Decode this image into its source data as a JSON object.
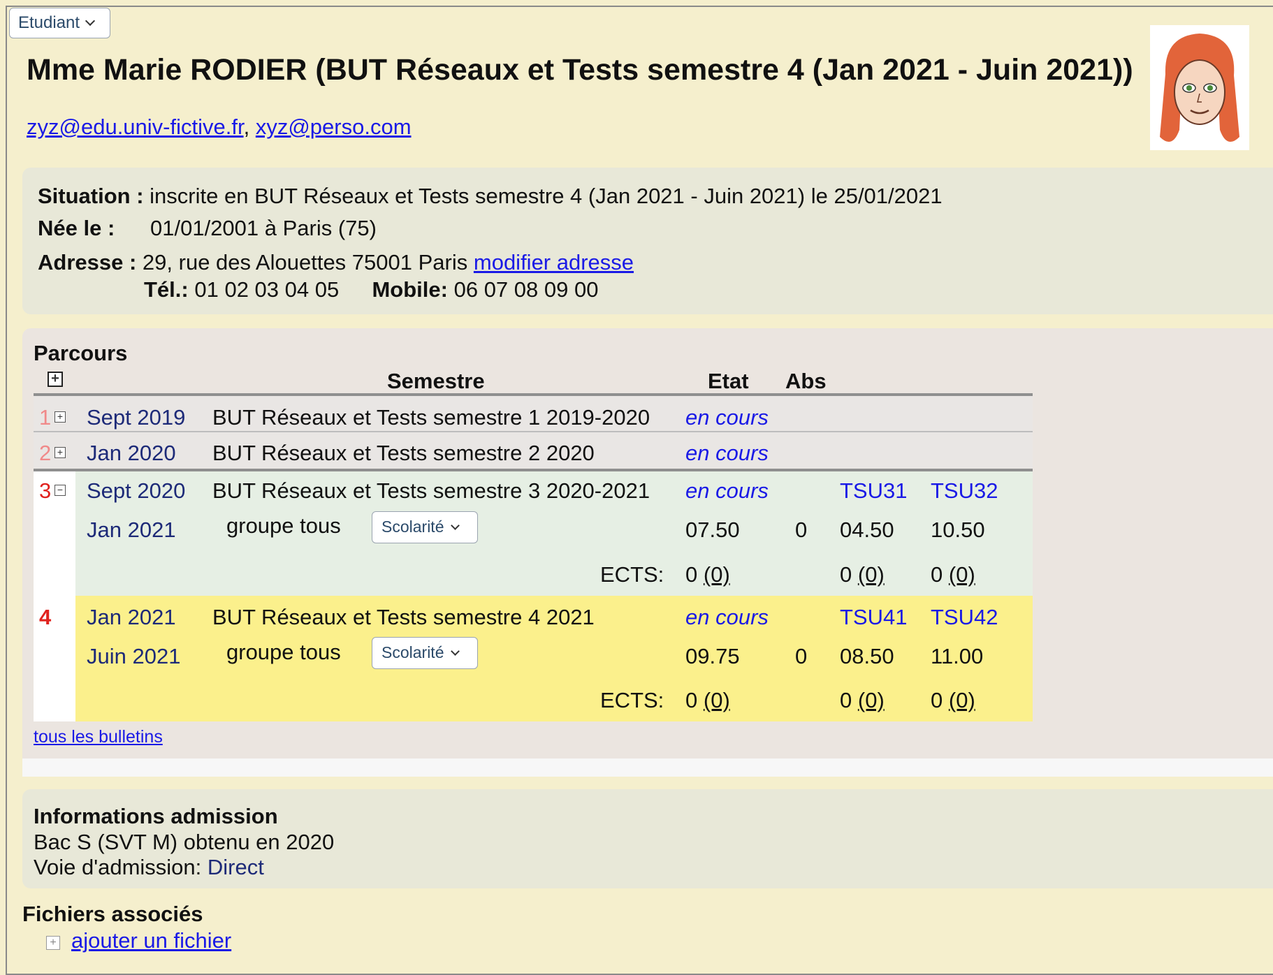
{
  "menu": {
    "label": "Etudiant"
  },
  "title": "Mme Marie RODIER (BUT Réseaux et Tests semestre 4 (Jan 2021 - Juin 2021))",
  "emails": {
    "primary": "zyz@edu.univ-fictive.fr",
    "separator": ",",
    "secondary": "xyz@perso.com"
  },
  "info": {
    "situation_label": "Situation :",
    "situation_value": "inscrite en BUT Réseaux et Tests semestre 4 (Jan 2021 - Juin 2021) le 25/01/2021",
    "birth_label": "Née le :",
    "birth_value": "01/01/2001 à Paris (75)",
    "address_label": "Adresse :",
    "address_value": "29, rue des Alouettes 75001 Paris",
    "address_link": "modifier adresse",
    "tel_label": "Tél.:",
    "tel_value": "01 02 03 04 05",
    "mobile_label": "Mobile:",
    "mobile_value": "06 07 08 09 00"
  },
  "parcours": {
    "heading": "Parcours",
    "columns": {
      "semestre": "Semestre",
      "etat": "Etat",
      "abs": "Abs"
    },
    "rows": [
      {
        "num": "1",
        "date": "Sept 2019",
        "name": "BUT Réseaux et Tests semestre 1 2019-2020",
        "etat": "en cours"
      },
      {
        "num": "2",
        "date": "Jan 2020",
        "name": "BUT Réseaux et Tests semestre 2 2020",
        "etat": "en cours"
      },
      {
        "num": "3",
        "date_start": "Sept 2020",
        "date_end": "Jan 2021",
        "name": "BUT Réseaux et Tests semestre 3 2020-2021",
        "etat": "en cours",
        "ue1": "TSU31",
        "ue2": "TSU32",
        "group": "groupe tous",
        "select": "Scolarité",
        "moy": "07.50",
        "abs": "0",
        "ue1_val": "04.50",
        "ue2_val": "10.50",
        "ects_label": "ECTS:",
        "ects_a": "0",
        "ects_a_link": "(0)",
        "ects_b": "0",
        "ects_b_link": "(0)",
        "ects_c": "0",
        "ects_c_link": "(0)"
      },
      {
        "num": "4",
        "date_start": "Jan 2021",
        "date_end": "Juin 2021",
        "name": "BUT Réseaux et Tests semestre 4 2021",
        "etat": "en cours",
        "ue1": "TSU41",
        "ue2": "TSU42",
        "group": "groupe tous",
        "select": "Scolarité",
        "moy": "09.75",
        "abs": "0",
        "ue1_val": "08.50",
        "ue2_val": "11.00",
        "ects_label": "ECTS:",
        "ects_a": "0",
        "ects_a_link": "(0)",
        "ects_b": "0",
        "ects_b_link": "(0)",
        "ects_c": "0",
        "ects_c_link": "(0)"
      }
    ],
    "all_bulletins": "tous les bulletins"
  },
  "admission": {
    "heading": "Informations admission",
    "bac": "Bac S (SVT M) obtenu en 2020",
    "voie_label": "Voie d'admission:",
    "voie_value": "Direct"
  },
  "files": {
    "heading": "Fichiers associés",
    "add_link": "ajouter un fichier"
  },
  "colors": {
    "background": "#f5efcd",
    "current_row": "#fbf08c",
    "open_row": "#e6efe4",
    "link": "#1a1ae6"
  }
}
